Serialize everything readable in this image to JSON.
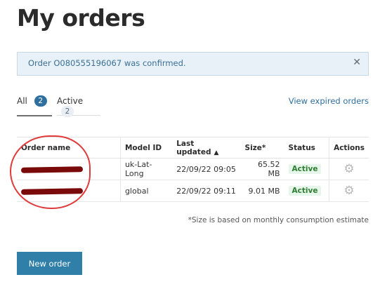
{
  "page": {
    "title": "My orders"
  },
  "alert": {
    "message": "Order O080555196067 was confirmed.",
    "close_icon": "close-icon"
  },
  "tabs": [
    {
      "label": "All",
      "count": "2"
    },
    {
      "label": "Active",
      "count": "2"
    }
  ],
  "expired_link": "View expired orders",
  "table": {
    "headers": [
      "Order name",
      "Model ID",
      "Last updated",
      "Size*",
      "Status",
      "Actions"
    ],
    "rows": [
      {
        "model_id": "uk-Lat-Long",
        "last_updated": "22/09/22 09:05",
        "size": "65.52 MB",
        "status": "Active"
      },
      {
        "model_id": "global",
        "last_updated": "22/09/22 09:11",
        "size": "9.01 MB",
        "status": "Active"
      }
    ]
  },
  "footnote": "*Size is based on monthly consumption estimate",
  "new_order_button": "New order",
  "colors": {
    "accent": "#2f7fa8",
    "link": "#2f6f9f",
    "status_active_bg": "#e7f6ea",
    "status_active_text": "#2e7d32",
    "annotation": "#e03a3a",
    "redaction": "#7a0a0a"
  }
}
